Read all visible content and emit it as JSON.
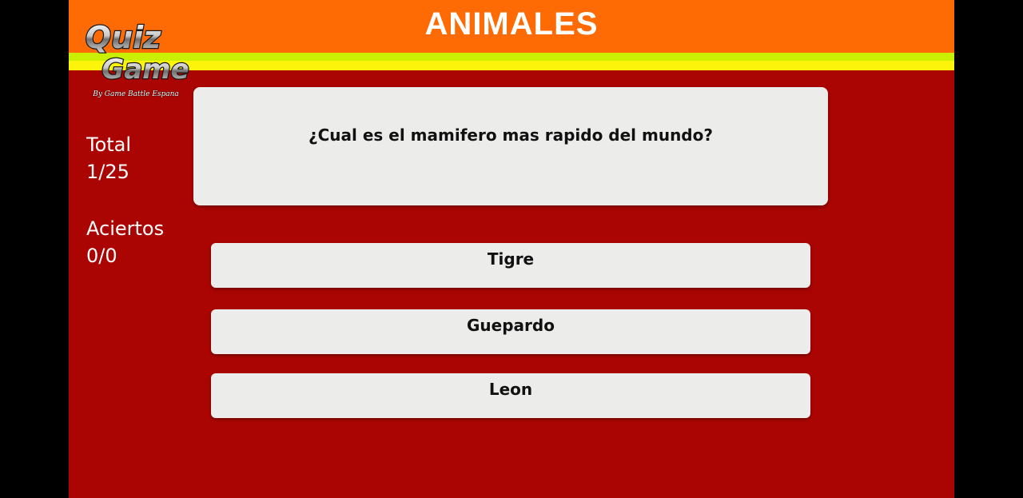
{
  "header": {
    "title": "ANIMALES"
  },
  "logo": {
    "line1": "Quiz",
    "line2": "Game",
    "tagline": "By Game Battle Espana"
  },
  "stats": {
    "total_label": "Total",
    "total_value": "1/25",
    "hits_label": "Aciertos",
    "hits_value": "0/0"
  },
  "question": {
    "text": "¿Cual es el mamifero mas rapido del mundo?"
  },
  "answers": [
    {
      "label": "Tigre"
    },
    {
      "label": "Guepardo"
    },
    {
      "label": "Leon"
    }
  ],
  "colors": {
    "background": "#ab0503",
    "header": "#fe6a03",
    "stripe_lime": "#c8f000",
    "stripe_yellow": "#fcf40a",
    "card": "#ececeb"
  }
}
